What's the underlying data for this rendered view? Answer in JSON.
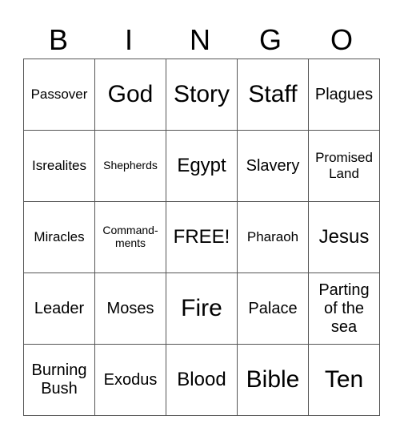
{
  "header": {
    "letters": [
      "B",
      "I",
      "N",
      "G",
      "O"
    ]
  },
  "card": {
    "rows": [
      [
        "Passover",
        "God",
        "Story",
        "Staff",
        "Plagues"
      ],
      [
        "Isrealites",
        "Shepherds",
        "Egypt",
        "Slavery",
        "Promised\nLand"
      ],
      [
        "Miracles",
        "Command-\nments",
        "FREE!",
        "Pharaoh",
        "Jesus"
      ],
      [
        "Leader",
        "Moses",
        "Fire",
        "Palace",
        "Parting\nof the\nsea"
      ],
      [
        "Burning\nBush",
        "Exodus",
        "Blood",
        "Bible",
        "Ten"
      ]
    ]
  }
}
